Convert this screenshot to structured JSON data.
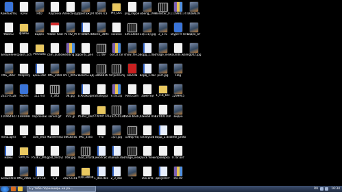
{
  "desktop": {
    "icons": [
      {
        "label": "Компьютер",
        "type": "app"
      },
      {
        "label": "Файлы",
        "type": "file"
      },
      {
        "label": "Безымянн",
        "type": "file"
      },
      {
        "label": "IMG_3667",
        "type": "img"
      },
      {
        "label": "2325-0128",
        "type": "img"
      },
      {
        "label": "110964947",
        "type": "img"
      },
      {
        "label": "нина.артх",
        "type": "file"
      },
      {
        "label": "мамы",
        "type": "doc"
      },
      {
        "label": "Безымянн",
        "type": "file"
      },
      {
        "label": "кучи",
        "type": "file"
      },
      {
        "label": "файлы",
        "type": "folder"
      },
      {
        "label": "splash_sch",
        "type": "file"
      },
      {
        "label": "fotoprizy",
        "type": "file"
      },
      {
        "label": "FILFim",
        "type": "app"
      },
      {
        "label": "4HHHHH",
        "type": "img"
      },
      {
        "label": "Tal",
        "type": "file"
      },
      {
        "label": "com_sc",
        "type": "folder"
      },
      {
        "label": "IMG_3665",
        "type": "img"
      },
      {
        "label": "P4D",
        "type": "img"
      },
      {
        "label": "видео",
        "type": "img"
      },
      {
        "label": "Реклама",
        "type": "folder"
      },
      {
        "label": "цены.doc",
        "type": "doc"
      },
      {
        "label": "1117kd",
        "type": "file"
      },
      {
        "label": "персонаж",
        "type": "file"
      },
      {
        "label": "com_tecx",
        "type": "file"
      },
      {
        "label": "P53K7_IMG",
        "type": "file"
      },
      {
        "label": "17.07.14",
        "type": "doc"
      },
      {
        "label": "Корзина",
        "type": "file"
      },
      {
        "label": "Adobe Reader",
        "type": "pdf"
      },
      {
        "label": "cam_audio",
        "type": "file"
      },
      {
        "label": "IMG_3664",
        "type": "img"
      },
      {
        "label": "4_3ft5",
        "type": "video"
      },
      {
        "label": "server.gif",
        "type": "img"
      },
      {
        "label": "Жизненный",
        "type": "file"
      },
      {
        "label": "gold_festiva",
        "type": "file"
      },
      {
        "label": "1_1",
        "type": "file"
      },
      {
        "label": "Александр",
        "type": "file"
      },
      {
        "label": "P3742_M",
        "type": "img"
      },
      {
        "label": "wedding.ap",
        "type": "archive"
      },
      {
        "label": "DVT_0052",
        "type": "img"
      },
      {
        "label": "08.jpg",
        "type": "img"
      },
      {
        "label": "mz2.jp",
        "type": "img"
      },
      {
        "label": "6863B.8s",
        "type": "img"
      },
      {
        "label": "068.jpg",
        "type": "img"
      },
      {
        "label": "20272101",
        "type": "img"
      },
      {
        "label": "фантаж.JPG",
        "type": "img"
      },
      {
        "label": "TF4BWA.doc",
        "type": "doc"
      },
      {
        "label": "points_pen",
        "type": "file"
      },
      {
        "label": "Визиты.БД",
        "type": "file"
      },
      {
        "label": "Б Анакорини",
        "type": "doc"
      },
      {
        "label": "P5362_Dec",
        "type": "file"
      },
      {
        "label": "IMG_3585",
        "type": "img"
      },
      {
        "label": "mod_Infarb",
        "type": "video"
      },
      {
        "label": "100CANON",
        "type": "folder"
      },
      {
        "label": "46667c3",
        "type": "img"
      },
      {
        "label": "6ce5_3895",
        "type": "img"
      },
      {
        "label": "c17a9",
        "type": "video"
      },
      {
        "label": "-2866816",
        "type": "video"
      },
      {
        "label": "Strategija",
        "type": "file"
      },
      {
        "label": "старый сайт",
        "type": "folder"
      },
      {
        "label": "что",
        "type": "file"
      },
      {
        "label": "Синопсис.doc",
        "type": "doc"
      },
      {
        "label": "1_doc.doc",
        "type": "doc"
      },
      {
        "label": "My_Doc",
        "type": "folder"
      },
      {
        "label": "канико",
        "type": "file"
      },
      {
        "label": "osc02.rar",
        "type": "archive"
      },
      {
        "label": "тогрепо.mp4",
        "type": "video"
      },
      {
        "label": "e.rar.zip",
        "type": "archive"
      },
      {
        "label": "-2325-0128",
        "type": "video"
      },
      {
        "label": "1(2).jpg",
        "type": "img"
      },
      {
        "label": "manual.doc",
        "type": "doc"
      },
      {
        "label": "2_3_doc",
        "type": "doc"
      },
      {
        "label": "pkg_skype",
        "type": "file"
      },
      {
        "label": "14013664",
        "type": "video"
      },
      {
        "label": "show_file.png",
        "type": "img"
      },
      {
        "label": "FileZilla",
        "type": "red"
      },
      {
        "label": "Rest.com",
        "type": "file"
      },
      {
        "label": "table.bash.jpg",
        "type": "img"
      },
      {
        "label": "1080p-hq",
        "type": "video"
      },
      {
        "label": "image_viewer",
        "type": "video"
      },
      {
        "label": "1",
        "type": "img"
      },
      {
        "label": "vibeng_199",
        "type": "img"
      },
      {
        "label": "11(111).jpg",
        "type": "img"
      },
      {
        "label": "Ворд_1.doc",
        "type": "doc"
      },
      {
        "label": "Ворд_1.doc",
        "type": "doc"
      },
      {
        "label": "Заметки",
        "type": "file"
      },
      {
        "label": "Южная Азия",
        "type": "file"
      },
      {
        "label": "Белоусов",
        "type": "file"
      },
      {
        "label": "Quick Viewer",
        "type": "file"
      },
      {
        "label": "101.arts",
        "type": "file"
      },
      {
        "label": "Hollister_0.",
        "type": "video"
      },
      {
        "label": "2_2.ru",
        "type": "img"
      },
      {
        "label": "image_viewer",
        "type": "img"
      },
      {
        "label": "part.jpg",
        "type": "img"
      },
      {
        "label": "1_4.b_kec",
        "type": "folder"
      },
      {
        "label": "KEY40110AB",
        "type": "file"
      },
      {
        "label": "Ворд_2.doc",
        "type": "doc"
      },
      {
        "label": "проверка",
        "type": "file"
      },
      {
        "label": "документ",
        "type": "doc"
      },
      {
        "label": "111994174",
        "type": "archive"
      },
      {
        "label": "Skype-R Total",
        "type": "app"
      },
      {
        "label": "soundn.wav",
        "type": "music"
      },
      {
        "label": "Heg",
        "type": "img"
      },
      {
        "label": "1299945",
        "type": "img"
      },
      {
        "label": "видео",
        "type": "img"
      },
      {
        "label": "dmtl_proto",
        "type": "file"
      },
      {
        "label": "0.rar.вот",
        "type": "file"
      },
      {
        "label": "sfx.rar",
        "type": "archive"
      },
      {
        "label": "b6a9629",
        "type": "img"
      },
      {
        "label": "видео_ат",
        "type": "img"
      },
      {
        "label": "mg002.jpg",
        "type": "img"
      }
    ]
  },
  "taskbar": {
    "window_title": "а у тебе порноширь на ра...",
    "language": "RU",
    "clock": "16:34"
  }
}
